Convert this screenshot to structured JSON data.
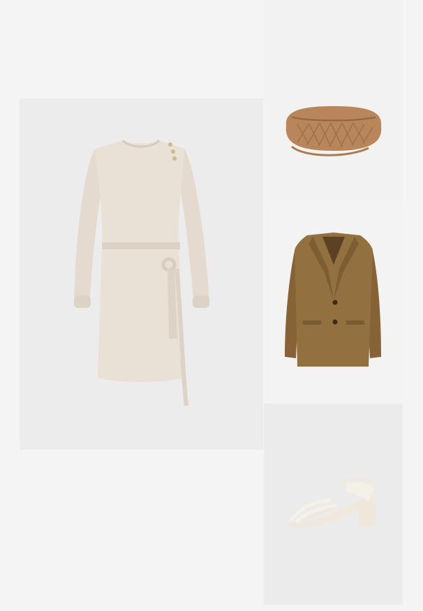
{
  "outfit": {
    "items": [
      {
        "id": "dress",
        "icon": "knit-dress-icon",
        "color": "#e6ddd2"
      },
      {
        "id": "bag",
        "icon": "woven-pouch-bag-icon",
        "color": "#b9875a"
      },
      {
        "id": "blazer",
        "icon": "suede-blazer-icon",
        "color": "#8e6a3d"
      },
      {
        "id": "sandal",
        "icon": "block-heel-sandal-icon",
        "color": "#efe9df"
      }
    ]
  }
}
